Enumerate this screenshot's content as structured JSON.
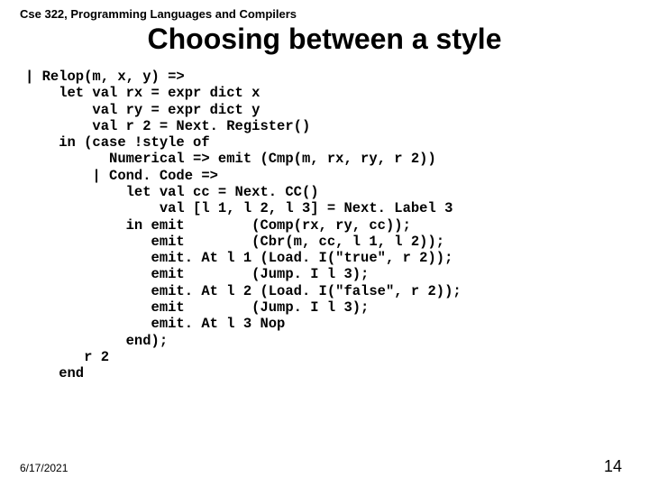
{
  "course": "Cse 322, Programming Languages and Compilers",
  "title": "Choosing between a style",
  "code": "| Relop(m, x, y) =>\n    let val rx = expr dict x\n        val ry = expr dict y\n        val r 2 = Next. Register()\n    in (case !style of\n          Numerical => emit (Cmp(m, rx, ry, r 2))\n        | Cond. Code =>\n            let val cc = Next. CC()\n                val [l 1, l 2, l 3] = Next. Label 3\n            in emit        (Comp(rx, ry, cc));\n               emit        (Cbr(m, cc, l 1, l 2));\n               emit. At l 1 (Load. I(\"true\", r 2));\n               emit        (Jump. I l 3);\n               emit. At l 2 (Load. I(\"false\", r 2));\n               emit        (Jump. I l 3);\n               emit. At l 3 Nop\n            end);\n       r 2\n    end",
  "footer": {
    "date": "6/17/2021",
    "page": "14"
  }
}
